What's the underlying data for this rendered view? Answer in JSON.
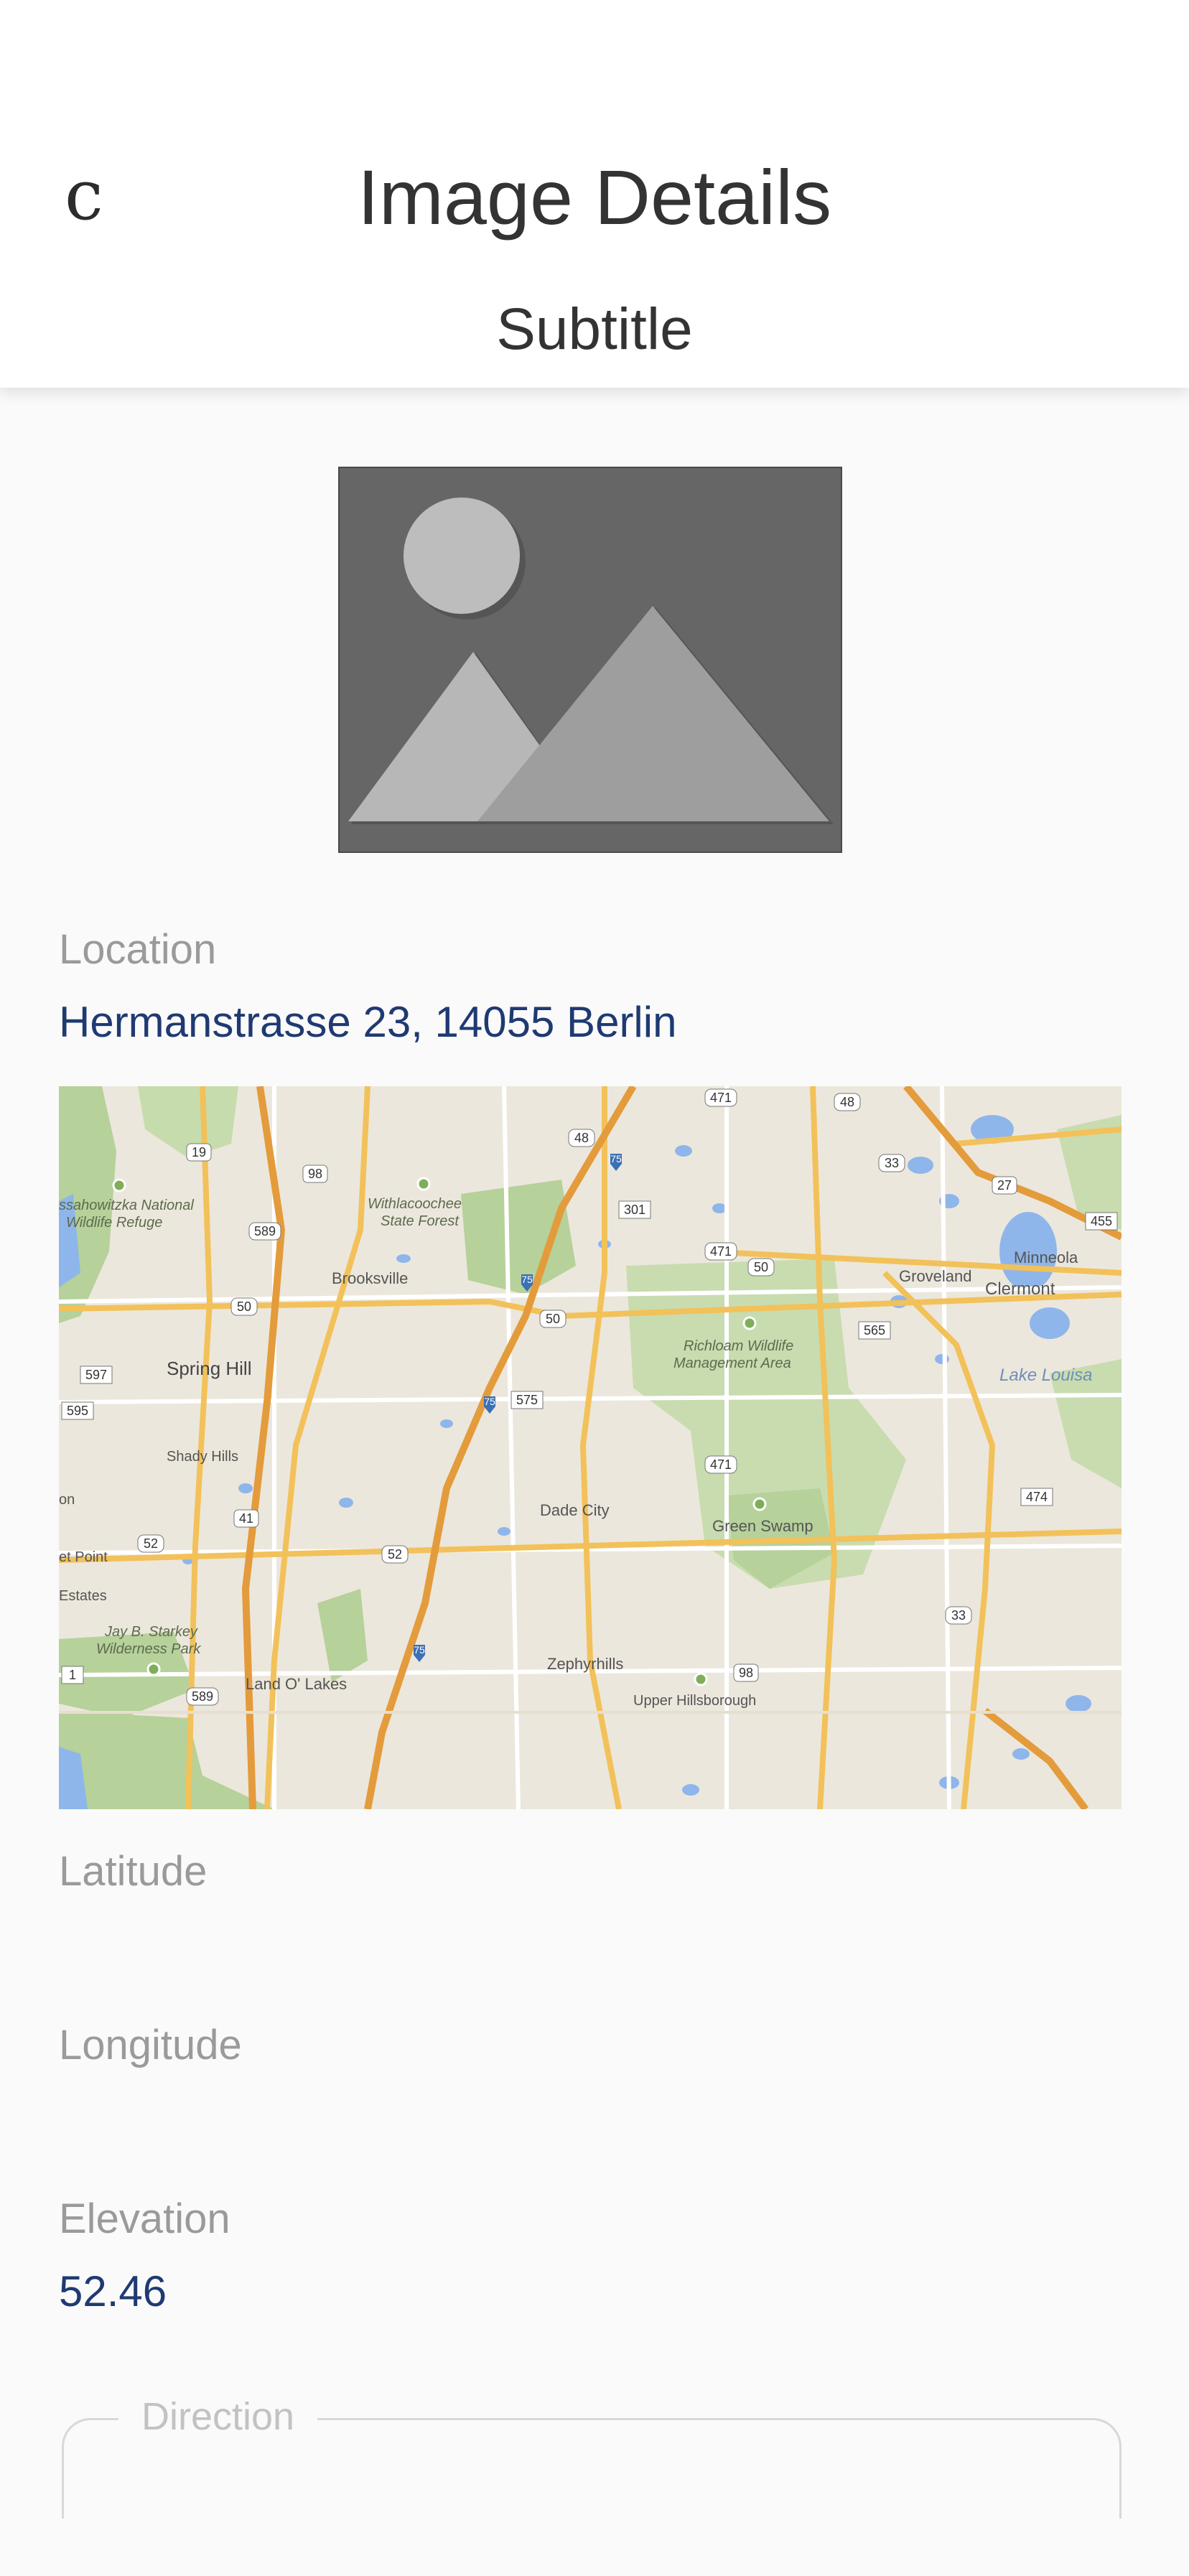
{
  "header": {
    "back_glyph": "c",
    "title": "Image Details",
    "subtitle": "Subtitle"
  },
  "image": {
    "icon": "image-placeholder-icon"
  },
  "location": {
    "label": "Location",
    "value": "Hermanstrasse 23, 14055 Berlin"
  },
  "map": {
    "places": [
      "Brooksville",
      "Spring Hill",
      "Shady Hills",
      "Dade City",
      "Zephyrhills",
      "Land O' Lakes",
      "Upper Hillsborough",
      "Green Swamp",
      "Groveland",
      "Minneola",
      "Clermont",
      "Lake Louisa",
      "Withlacoochee State Forest",
      "Chassahowitzka National Wildlife Refuge",
      "Richloam Wildlife Management Area",
      "Jay B. Starkey Wilderness Park",
      "Estates",
      "Point"
    ],
    "highway_shields": [
      "19",
      "98",
      "589",
      "50",
      "597",
      "595",
      "41",
      "52",
      "75",
      "301",
      "471",
      "48",
      "33",
      "27",
      "455",
      "565",
      "575",
      "474",
      "1"
    ]
  },
  "latitude": {
    "label": "Latitude",
    "value": ""
  },
  "longitude": {
    "label": "Longitude",
    "value": ""
  },
  "elevation": {
    "label": "Elevation",
    "value": "52.46"
  },
  "direction": {
    "label": "Direction"
  },
  "colors": {
    "accent_text": "#1f3a72",
    "label_text": "#9a9a9a",
    "placeholder_bg": "#666666"
  }
}
